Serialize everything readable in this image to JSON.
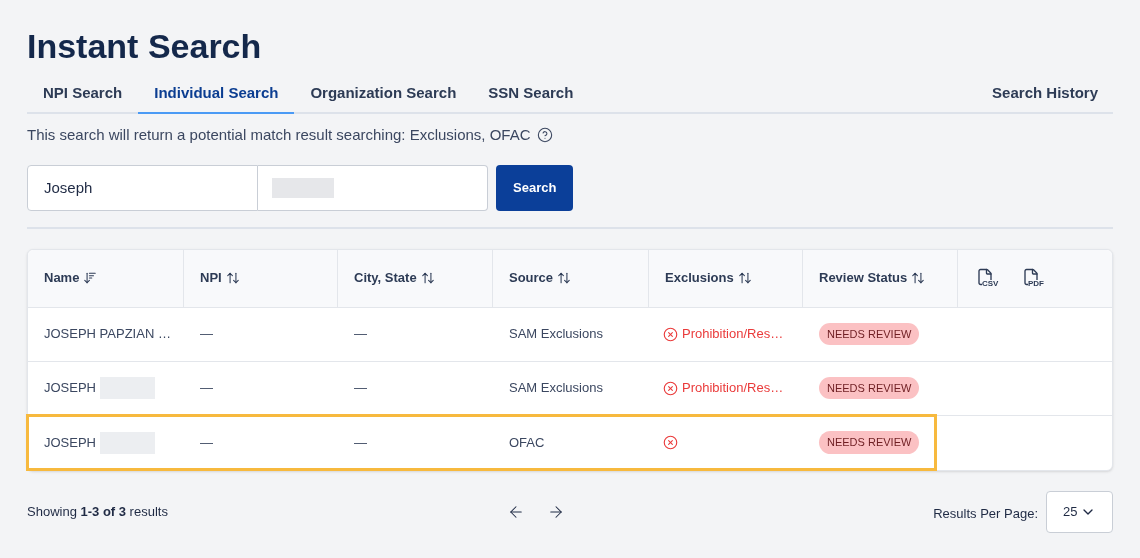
{
  "title": "Instant Search",
  "tabs": [
    {
      "label": "NPI Search",
      "selected": false
    },
    {
      "label": "Individual Search",
      "selected": true
    },
    {
      "label": "Organization Search",
      "selected": false
    },
    {
      "label": "SSN Search",
      "selected": false
    }
  ],
  "history_link": "Search History",
  "info_text": "This search will return a potential match result searching: Exclusions, OFAC",
  "search": {
    "first_name": "Joseph",
    "last_name_redacted": true,
    "button": "Search"
  },
  "table": {
    "columns": [
      {
        "label": "Name",
        "sorted": true
      },
      {
        "label": "NPI",
        "sorted": false
      },
      {
        "label": "City, State",
        "sorted": false
      },
      {
        "label": "Source",
        "sorted": false
      },
      {
        "label": "Exclusions",
        "sorted": false
      },
      {
        "label": "Review Status",
        "sorted": false
      }
    ],
    "exports": [
      "CSV",
      "PDF"
    ],
    "rows": [
      {
        "name": "JOSEPH PAPZIAN …",
        "npi": "—",
        "city_state": "—",
        "source": "SAM Exclusions",
        "exclusion": "Prohibition/Res…",
        "status": "NEEDS REVIEW",
        "highlighted": false
      },
      {
        "name": "JOSEPH",
        "name_redacted": true,
        "npi": "—",
        "city_state": "—",
        "source": "SAM Exclusions",
        "exclusion": "Prohibition/Res…",
        "status": "NEEDS REVIEW",
        "highlighted": false
      },
      {
        "name": "JOSEPH",
        "name_redacted": true,
        "npi": "—",
        "city_state": "—",
        "source": "OFAC",
        "status": "NEEDS REVIEW",
        "highlighted": true
      }
    ]
  },
  "footer": {
    "showing": "Showing **1-3 of 3** results",
    "per_page_label": "Results Per Page:",
    "per_page": "25"
  }
}
